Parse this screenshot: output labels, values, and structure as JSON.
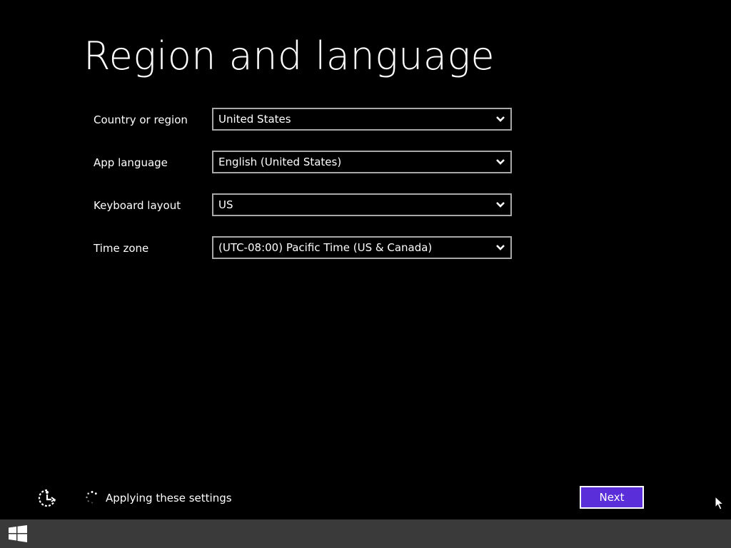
{
  "page": {
    "title": "Region and language"
  },
  "form": {
    "fields": [
      {
        "label": "Country or region",
        "value": "United States"
      },
      {
        "label": "App language",
        "value": "English (United States)"
      },
      {
        "label": "Keyboard layout",
        "value": "US"
      },
      {
        "label": "Time zone",
        "value": "(UTC-08:00) Pacific Time (US & Canada)"
      }
    ]
  },
  "footer": {
    "ease_of_access_icon": "ease-of-access-icon",
    "status_text": "Applying these settings",
    "next_label": "Next"
  },
  "taskbar": {
    "start_icon": "windows-logo-icon"
  },
  "colors": {
    "background": "#000000",
    "accent": "#5a2ed8",
    "border": "#a8a8a8",
    "taskbar": "#3a3a3a"
  }
}
